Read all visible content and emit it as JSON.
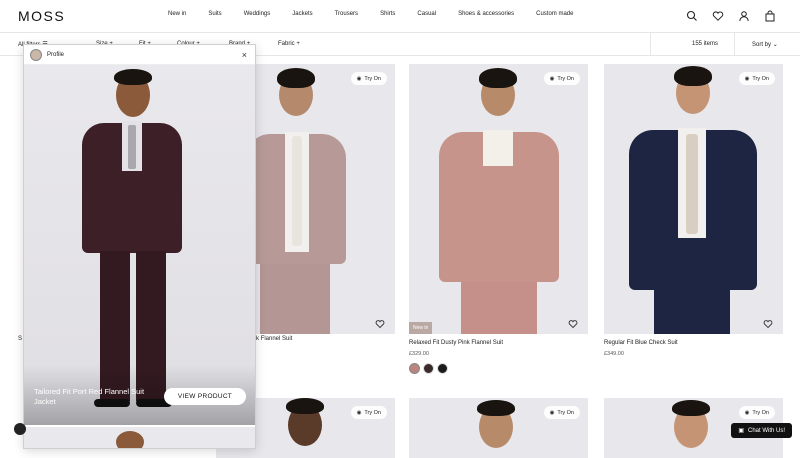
{
  "header": {
    "logo": "MOSS",
    "nav": [
      "New in",
      "Suits",
      "Weddings",
      "Jackets",
      "Trousers",
      "Shirts",
      "Casual",
      "Shoes & accessories",
      "Custom made"
    ],
    "icons": [
      "search-icon",
      "heart-icon",
      "user-icon",
      "bag-icon"
    ]
  },
  "filters": {
    "all_filters": "All filters",
    "size": "Size",
    "fit": "Fit",
    "colour": "Colour",
    "brand": "Brand",
    "fabric": "Fabric",
    "plus": "+",
    "count": "155 items",
    "sort": "Sort by"
  },
  "overlay": {
    "title": "Profile",
    "close": "×",
    "caption": "Tailored Fit Port Red Flannel Suit Jacket",
    "button": "VIEW PRODUCT"
  },
  "products": [
    {
      "name": "k Flannel Suit",
      "price": "",
      "try_on": "Try On",
      "badge": "",
      "colors": {
        "jacket": "#b79a98",
        "tie": "#e8e4de",
        "legs": "#b49694"
      }
    },
    {
      "name": "Relaxed Fit Dusty Pink Flannel Suit",
      "price": "£329.00",
      "try_on": "Try On",
      "badge": "New in",
      "colors": {
        "jacket": "#c7948b",
        "tie": "",
        "legs": "#c49089"
      },
      "swatches": [
        "#b9857c",
        "#3a2a2c",
        "#1b1b1b"
      ]
    },
    {
      "name": "Regular Fit Blue Check Suit",
      "price": "£349.00",
      "try_on": "Try On",
      "badge": "",
      "colors": {
        "jacket": "#1d2543",
        "tie": "#d8cfc2",
        "legs": "#1d2543"
      }
    },
    {
      "name": "",
      "price": "",
      "try_on": "Try On",
      "badge": "",
      "colors": {}
    },
    {
      "name": "",
      "price": "",
      "try_on": "Try On",
      "badge": "",
      "colors": {}
    },
    {
      "name": "",
      "price": "",
      "try_on": "Try On",
      "badge": "",
      "colors": {}
    }
  ],
  "left_cut": "S",
  "chat": {
    "label": "Chat With Us!"
  }
}
